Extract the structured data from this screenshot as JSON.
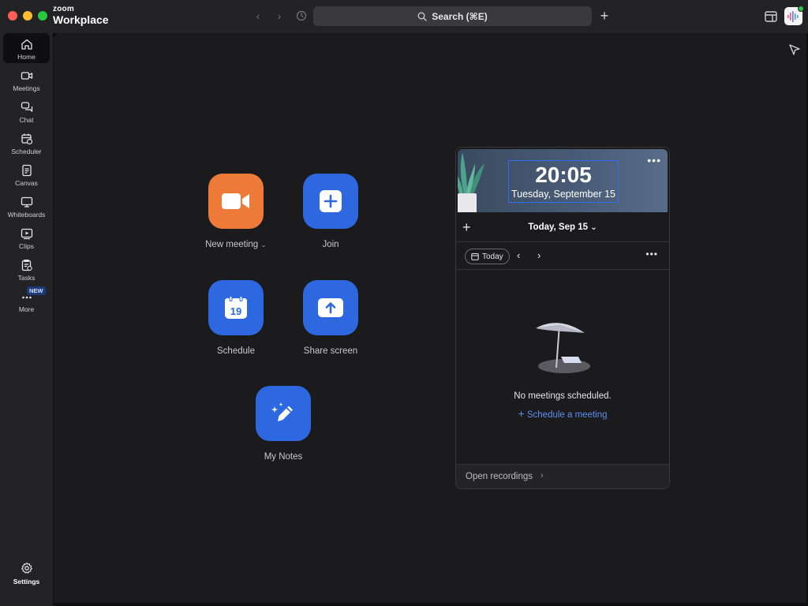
{
  "titlebar": {
    "brand_small": "zoom",
    "brand_big": "Workplace",
    "search_label": "Search (⌘E)"
  },
  "sidebar": {
    "items": [
      {
        "label": "Home",
        "icon": "home-icon"
      },
      {
        "label": "Meetings",
        "icon": "video-camera-icon"
      },
      {
        "label": "Chat",
        "icon": "chat-icon"
      },
      {
        "label": "Scheduler",
        "icon": "scheduler-icon"
      },
      {
        "label": "Canvas",
        "icon": "document-icon"
      },
      {
        "label": "Whiteboards",
        "icon": "whiteboard-icon"
      },
      {
        "label": "Clips",
        "icon": "clips-icon"
      },
      {
        "label": "Tasks",
        "icon": "tasks-icon"
      },
      {
        "label": "More",
        "icon": "more-dots-icon"
      }
    ],
    "new_badge": "NEW",
    "settings_label": "Settings"
  },
  "actions": {
    "new_meeting": "New meeting",
    "join": "Join",
    "schedule": "Schedule",
    "schedule_day": "19",
    "share_screen": "Share screen",
    "my_notes": "My Notes"
  },
  "calendar": {
    "time": "20:05",
    "date_long": "Tuesday, September 15",
    "date_selector": "Today, Sep 15",
    "today_button": "Today",
    "empty_text": "No meetings scheduled.",
    "schedule_link": "Schedule a meeting",
    "open_recordings": "Open recordings"
  },
  "colors": {
    "accent_blue": "#2d68e0",
    "accent_orange": "#ee7a3a",
    "link_blue": "#5b8ff0"
  }
}
